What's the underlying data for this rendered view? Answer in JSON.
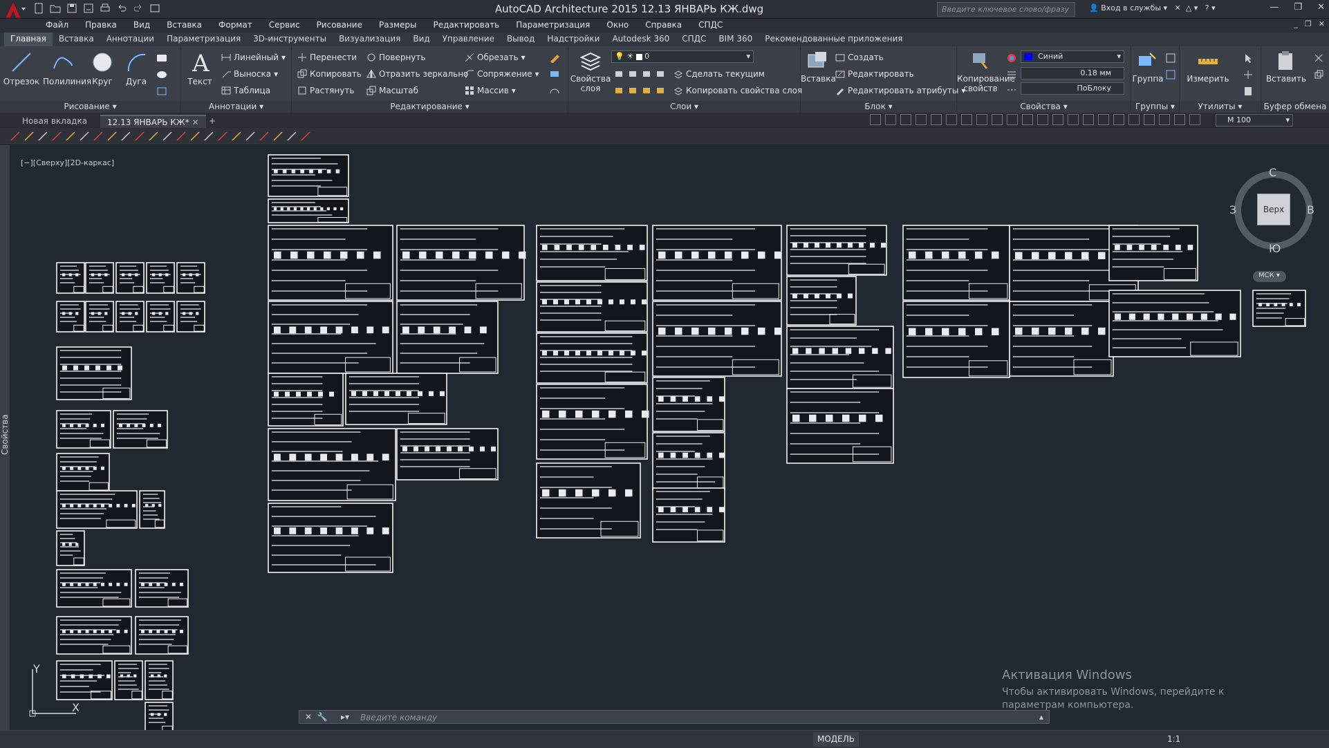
{
  "window": {
    "title": "AutoCAD Architecture 2015     12.13 ЯНВАРЬ КЖ.dwg",
    "search_placeholder": "Введите ключевое слово/фразу",
    "signin": "Вход в службы"
  },
  "menu": [
    "Файл",
    "Правка",
    "Вид",
    "Вставка",
    "Формат",
    "Сервис",
    "Рисование",
    "Размеры",
    "Редактировать",
    "Параметризация",
    "Окно",
    "Справка",
    "СПДС"
  ],
  "ribbon_tabs": [
    "Главная",
    "Вставка",
    "Аннотации",
    "Параметризация",
    "3D-инструменты",
    "Визуализация",
    "Вид",
    "Управление",
    "Вывод",
    "Надстройки",
    "Autodesk 360",
    "СПДС",
    "BIM 360",
    "Рекомендованные приложения"
  ],
  "panels": {
    "draw": {
      "title": "Рисование",
      "line": "Отрезок",
      "polyline": "Полилиния",
      "circle": "Круг",
      "arc": "Дуга"
    },
    "annotate": {
      "title": "Аннотации",
      "text": "Текст",
      "linear": "Линейный",
      "leader": "Выноска",
      "table": "Таблица"
    },
    "modify": {
      "title": "Редактирование",
      "move": "Перенести",
      "rotate": "Повернуть",
      "trim": "Обрезать",
      "copy": "Копировать",
      "mirror": "Отразить зеркально",
      "fillet": "Сопряжение",
      "stretch": "Растянуть",
      "scale": "Масштаб",
      "array": "Массив"
    },
    "layers": {
      "title": "Слои",
      "props": "Свойства слоя",
      "layer_value": "0",
      "make_current": "Сделать текущим",
      "match": "Копировать свойства слоя"
    },
    "block": {
      "title": "Блок",
      "insert": "Вставка",
      "create": "Создать",
      "edit": "Редактировать",
      "edit_attr": "Редактировать атрибуты"
    },
    "properties": {
      "title": "Свойства",
      "match": "Копирование свойств",
      "color": "Синий",
      "lineweight": "0.18 мм",
      "linetype": "ПоБлоку"
    },
    "groups": {
      "title": "Группы",
      "group": "Группа"
    },
    "utilities": {
      "title": "Утилиты",
      "measure": "Измерить"
    },
    "clipboard": {
      "title": "Буфер обмена",
      "paste": "Вставить"
    }
  },
  "doc_tabs": {
    "new": "Новая вкладка",
    "current": "12.13 ЯНВАРЬ КЖ*",
    "plus": "+"
  },
  "scale_value": "М 100",
  "viewport_label": "[−][Сверху][2D-каркас]",
  "side_panel": "Свойства",
  "viewcube": {
    "top": "Верх",
    "north": "С",
    "south": "Ю",
    "west": "З",
    "east": "В",
    "wcs": "МСК"
  },
  "ucs": {
    "x": "X",
    "y": "Y"
  },
  "activation": {
    "title": "Активация Windows",
    "body": "Чтобы активировать Windows, перейдите к параметрам компьютера."
  },
  "command_placeholder": "Введите команду",
  "status": {
    "model": "МОДЕЛЬ",
    "annotation_scale": "1:1"
  },
  "colors": {
    "accent": "#0000ff",
    "sheet": "#ffffff",
    "canvas": "#212830"
  }
}
